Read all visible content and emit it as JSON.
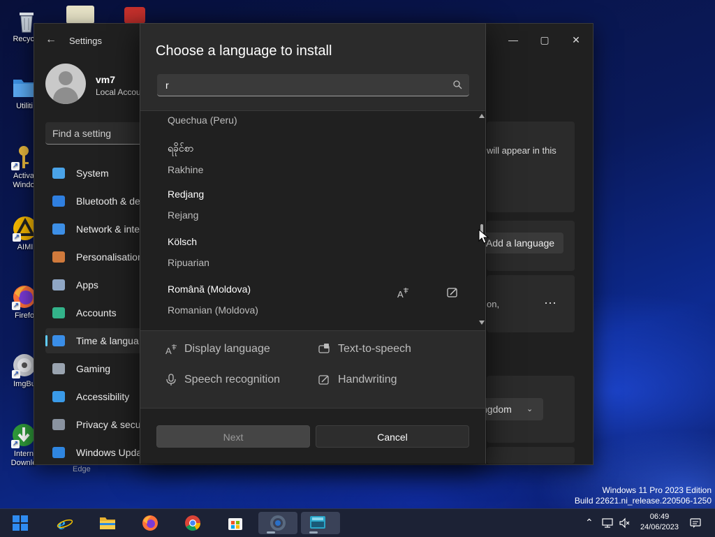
{
  "desktop": {
    "icons": [
      {
        "label": "Recycle",
        "icon": "recycle-bin-icon"
      },
      {
        "label": "Utiliti",
        "icon": "folder-icon"
      },
      {
        "label": "Activa Windo",
        "icon": "key-icon"
      },
      {
        "label": "AIMI",
        "icon": "aimp-icon"
      },
      {
        "label": "Firefo",
        "icon": "firefox-icon"
      },
      {
        "label": "ImgBu",
        "icon": "disc-icon"
      },
      {
        "label": "Intern Downlo",
        "icon": "download-manager-icon"
      }
    ],
    "edge_label": "Edge"
  },
  "settings": {
    "title": "Settings",
    "profile": {
      "name": "vm7",
      "subtitle": "Local Accou"
    },
    "search_placeholder": "Find a setting",
    "nav": [
      {
        "label": "System",
        "icon": "monitor-icon",
        "color": "#4aa3e8"
      },
      {
        "label": "Bluetooth & de",
        "icon": "bluetooth-icon",
        "color": "#2f7fe0"
      },
      {
        "label": "Network & inte",
        "icon": "wifi-icon",
        "color": "#3d8fe6"
      },
      {
        "label": "Personalisation",
        "icon": "brush-icon",
        "color": "#d07a3c"
      },
      {
        "label": "Apps",
        "icon": "apps-icon",
        "color": "#8fa6c4"
      },
      {
        "label": "Accounts",
        "icon": "person-icon",
        "color": "#33b38a"
      },
      {
        "label": "Time & langua",
        "icon": "globe-clock-icon",
        "color": "#3a8ee8",
        "active": true
      },
      {
        "label": "Gaming",
        "icon": "gamepad-icon",
        "color": "#9aa4b0"
      },
      {
        "label": "Accessibility",
        "icon": "accessibility-icon",
        "color": "#3a9ae8"
      },
      {
        "label": "Privacy & secu",
        "icon": "shield-icon",
        "color": "#8a93a0"
      },
      {
        "label": "Windows Upda",
        "icon": "update-icon",
        "color": "#2f86e0"
      }
    ],
    "right": {
      "panel_text": "will appear in this",
      "add_language": "Add a language",
      "lang_card_text": "on,",
      "more": "⋯",
      "region_value": "ngdom"
    }
  },
  "dialog": {
    "title": "Choose a language to install",
    "search_value": "r",
    "languages": [
      {
        "native": "",
        "english": "Quechua (Peru)"
      },
      {
        "native": "ရခိုင်စာ",
        "english": "Rakhine"
      },
      {
        "native": "Redjang",
        "english": "Rejang"
      },
      {
        "native": "Kölsch",
        "english": "Ripuarian"
      },
      {
        "native": "Română (Moldova)",
        "english": "Romanian (Moldova)"
      }
    ],
    "legend": {
      "display_language": "Display language",
      "text_to_speech": "Text-to-speech",
      "speech_recognition": "Speech recognition",
      "handwriting": "Handwriting"
    },
    "buttons": {
      "next": "Next",
      "cancel": "Cancel"
    }
  },
  "watermark": {
    "line1": "Windows 11 Pro 2023 Edition",
    "line2": "Build 22621.ni_release.220506-1250"
  },
  "taskbar": {
    "apps": [
      "start-icon",
      "internet-explorer-icon",
      "file-explorer-icon",
      "firefox-icon",
      "chrome-icon",
      "microsoft-store-icon",
      "settings-app-icon",
      "on-screen-keyboard-icon"
    ],
    "time": "06:49",
    "date": "24/06/2023"
  }
}
